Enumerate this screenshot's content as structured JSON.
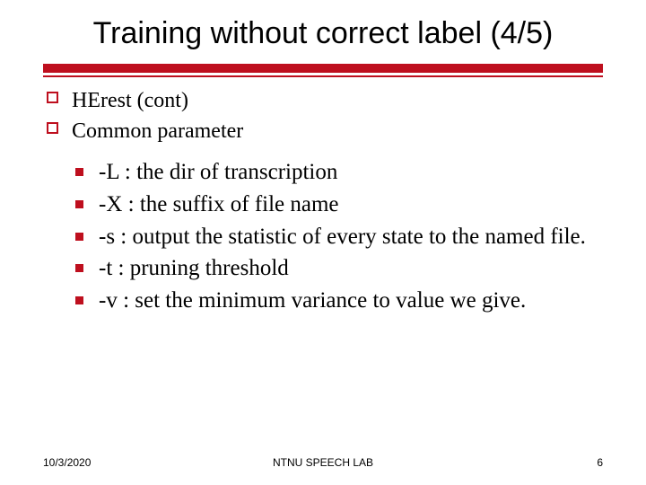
{
  "title": "Training without correct label (4/5)",
  "level1": [
    {
      "text": "HErest (cont)"
    },
    {
      "text": "Common parameter"
    }
  ],
  "level2": [
    {
      "text": "-L : the dir of transcription"
    },
    {
      "text": "-X : the suffix of file name"
    },
    {
      "text": "-s : output the statistic of every state to the named file."
    },
    {
      "text": "-t : pruning threshold"
    },
    {
      "text": "-v : set the minimum variance to value we give."
    }
  ],
  "footer": {
    "date": "10/3/2020",
    "center": "NTNU SPEECH LAB",
    "page": "6"
  },
  "colors": {
    "accent": "#be0f1e"
  }
}
